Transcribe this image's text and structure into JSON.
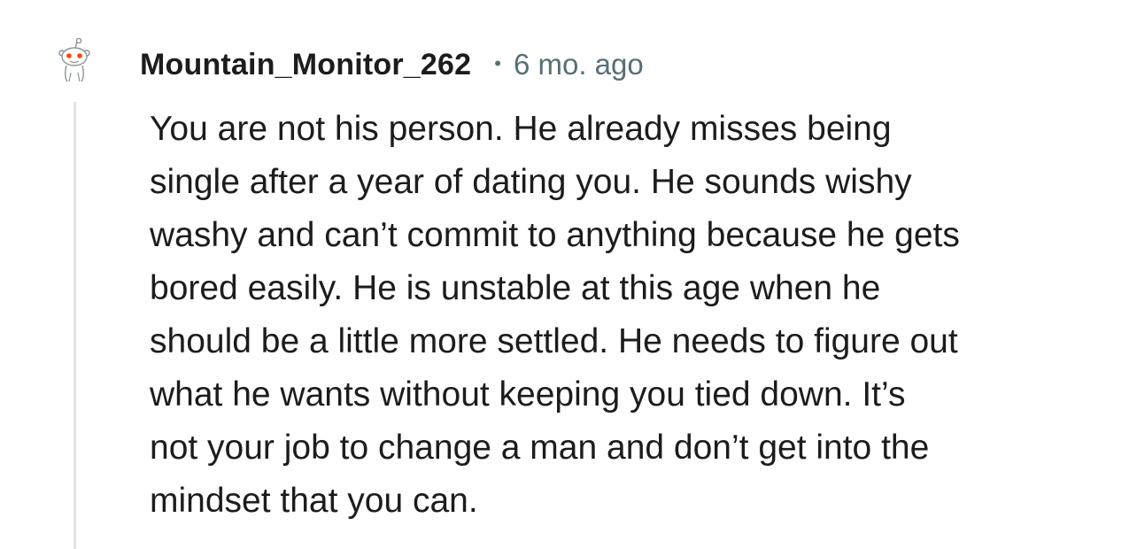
{
  "comment": {
    "author": "Mountain_Monitor_262",
    "separator": "•",
    "timestamp": "6 mo. ago",
    "avatar_icon": "reddit-snoo-icon",
    "body_lines": [
      "You are not his person. He already misses being",
      "single after a year of dating you. He sounds wishy",
      "washy and can’t commit to anything because he gets",
      "bored easily. He is unstable at this age when he",
      "should be a little more settled. He needs to figure out",
      "what he wants without keeping you tied down. It’s",
      "not your job to change a man and don’t get into the",
      "mindset that you can."
    ]
  },
  "colors": {
    "text": "#1c1c1c",
    "meta": "#576f76",
    "thread_line": "#dfe3e5",
    "snoo_eye": "#ff4500"
  }
}
